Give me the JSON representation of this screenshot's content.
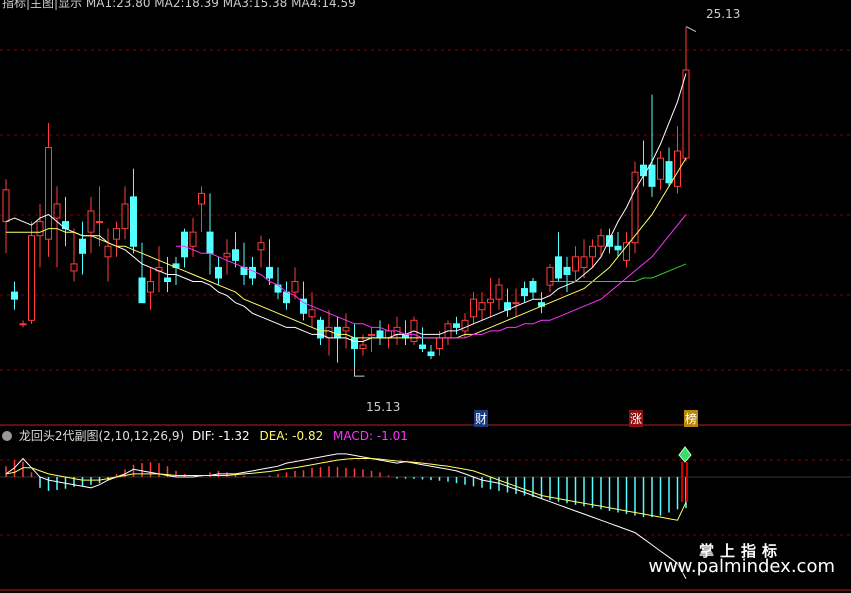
{
  "colors": {
    "up": "#ff3b3b",
    "down": "#54ffff",
    "ma1": "#ffffff",
    "ma2": "#ffff66",
    "ma3": "#ff33ff",
    "ma4": "#33cc33",
    "grid": "#8b0000",
    "divider": "#b22222",
    "dif": "#ffffff",
    "dea": "#ffff66",
    "macd_label": "#ff33ff"
  },
  "header": {
    "top_text": "指标|主图|显示  MA1:23.80  MA2:18.39  MA3:15.38  MA4:14.59",
    "sub_title": "龙回头2代副图(2,10,12,26,9)",
    "dif_label": "DIF: -1.32",
    "dea_label": "DEA: -0.82",
    "macd_label": "MACD: -1.01"
  },
  "annotations": {
    "high_label": "25.13",
    "low_label": "15.13",
    "tag_cai": "财",
    "tag_zhang": "涨",
    "tag_bang": "榜"
  },
  "watermark": {
    "line1": "掌上指标",
    "line2": "www.palmindex.com"
  },
  "chart_data": [
    {
      "type": "candlestick",
      "title": "",
      "ylim": [
        14.2,
        25.6
      ],
      "candles": [
        [
          19.6,
          20.8,
          18.7,
          20.5
        ],
        [
          17.6,
          17.9,
          17.1,
          17.4
        ],
        [
          16.7,
          16.8,
          16.6,
          16.7
        ],
        [
          16.8,
          19.6,
          16.7,
          19.2
        ],
        [
          19.2,
          20.1,
          18.3,
          19.6
        ],
        [
          19.1,
          22.4,
          18.6,
          21.7
        ],
        [
          19.7,
          20.6,
          18.3,
          20.1
        ],
        [
          19.6,
          20.3,
          18.9,
          19.4
        ],
        [
          18.2,
          19.4,
          17.9,
          18.4
        ],
        [
          19.1,
          19.6,
          18.1,
          18.7
        ],
        [
          19.3,
          20.3,
          18.7,
          19.9
        ],
        [
          19.6,
          20.6,
          18.9,
          19.6
        ],
        [
          18.6,
          19.4,
          17.9,
          18.9
        ],
        [
          19.1,
          19.6,
          18.6,
          19.4
        ],
        [
          19.4,
          20.6,
          19.1,
          20.1
        ],
        [
          20.3,
          21.1,
          18.7,
          18.9
        ],
        [
          18.0,
          19.0,
          17.3,
          17.3
        ],
        [
          17.6,
          18.3,
          17.1,
          17.9
        ],
        [
          18.2,
          18.9,
          17.6,
          18.3
        ],
        [
          18.0,
          18.6,
          17.6,
          17.9
        ],
        [
          18.4,
          18.6,
          17.8,
          18.3
        ],
        [
          19.3,
          19.4,
          18.3,
          18.6
        ],
        [
          18.9,
          19.7,
          18.6,
          19.3
        ],
        [
          20.1,
          20.6,
          19.3,
          20.4
        ],
        [
          19.3,
          20.4,
          18.1,
          18.7
        ],
        [
          18.3,
          18.6,
          17.8,
          18.0
        ],
        [
          18.6,
          19.1,
          18.1,
          18.7
        ],
        [
          18.8,
          19.3,
          18.3,
          18.5
        ],
        [
          18.3,
          19.0,
          17.8,
          18.1
        ],
        [
          18.3,
          18.6,
          17.8,
          18.0
        ],
        [
          18.8,
          19.2,
          18.3,
          19.0
        ],
        [
          18.3,
          19.1,
          17.8,
          18.0
        ],
        [
          17.8,
          18.3,
          17.4,
          17.6
        ],
        [
          17.6,
          17.9,
          17.1,
          17.3
        ],
        [
          17.6,
          18.3,
          17.4,
          17.9
        ],
        [
          17.4,
          17.9,
          16.8,
          17.0
        ],
        [
          16.9,
          17.6,
          16.6,
          17.1
        ],
        [
          16.8,
          16.9,
          16.1,
          16.3
        ],
        [
          16.3,
          17.1,
          15.8,
          16.6
        ],
        [
          16.6,
          16.9,
          15.6,
          16.3
        ],
        [
          16.5,
          17.0,
          16.0,
          16.6
        ],
        [
          16.3,
          16.7,
          15.5,
          16.0
        ],
        [
          16.0,
          16.4,
          15.8,
          16.1
        ],
        [
          16.4,
          16.6,
          15.9,
          16.4
        ],
        [
          16.5,
          16.8,
          16.1,
          16.3
        ],
        [
          16.3,
          16.7,
          16.0,
          16.5
        ],
        [
          16.4,
          16.9,
          16.1,
          16.6
        ],
        [
          16.4,
          16.8,
          16.1,
          16.3
        ],
        [
          16.2,
          16.9,
          16.1,
          16.8
        ],
        [
          16.1,
          16.6,
          15.9,
          16.0
        ],
        [
          15.9,
          16.1,
          15.7,
          15.8
        ],
        [
          16.0,
          16.5,
          15.8,
          16.3
        ],
        [
          16.3,
          16.8,
          16.1,
          16.7
        ],
        [
          16.7,
          16.9,
          16.4,
          16.6
        ],
        [
          16.5,
          17.0,
          16.3,
          16.8
        ],
        [
          16.9,
          17.6,
          16.7,
          17.4
        ],
        [
          17.1,
          17.6,
          16.8,
          17.3
        ],
        [
          17.3,
          18.0,
          16.9,
          17.4
        ],
        [
          17.4,
          18.0,
          17.1,
          17.8
        ],
        [
          17.3,
          17.7,
          16.9,
          17.1
        ],
        [
          17.3,
          17.7,
          16.9,
          17.3
        ],
        [
          17.7,
          17.9,
          17.3,
          17.5
        ],
        [
          17.9,
          18.0,
          17.4,
          17.6
        ],
        [
          17.3,
          17.6,
          17.0,
          17.2
        ],
        [
          17.8,
          18.4,
          17.6,
          18.3
        ],
        [
          18.6,
          19.3,
          17.9,
          18.0
        ],
        [
          18.3,
          18.6,
          17.6,
          18.1
        ],
        [
          18.2,
          18.9,
          17.9,
          18.6
        ],
        [
          18.3,
          19.1,
          18.0,
          18.6
        ],
        [
          18.6,
          19.1,
          18.3,
          18.9
        ],
        [
          18.9,
          19.4,
          18.6,
          19.2
        ],
        [
          19.2,
          19.4,
          18.7,
          18.9
        ],
        [
          18.9,
          19.3,
          18.6,
          18.8
        ],
        [
          18.5,
          19.3,
          18.3,
          19.0
        ],
        [
          19.0,
          21.3,
          18.7,
          21.0
        ],
        [
          21.2,
          21.9,
          20.6,
          20.9
        ],
        [
          21.2,
          23.2,
          20.3,
          20.6
        ],
        [
          20.8,
          21.6,
          20.5,
          21.4
        ],
        [
          21.3,
          21.7,
          20.6,
          20.7
        ],
        [
          20.6,
          22.3,
          20.4,
          21.6
        ],
        [
          21.4,
          25.1,
          21.3,
          23.9
        ]
      ],
      "ma1": [
        19.6,
        19.7,
        19.6,
        19.5,
        19.7,
        19.8,
        19.6,
        19.4,
        19.3,
        19.2,
        19.2,
        19.2,
        19.0,
        18.9,
        18.8,
        18.6,
        18.4,
        18.3,
        18.2,
        18.1,
        18.1,
        18.0,
        17.9,
        17.9,
        17.8,
        17.6,
        17.5,
        17.3,
        17.2,
        17.0,
        16.9,
        16.8,
        16.7,
        16.6,
        16.6,
        16.5,
        16.4,
        16.4,
        16.3,
        16.3,
        16.3,
        16.2,
        16.2,
        16.3,
        16.3,
        16.3,
        16.4,
        16.4,
        16.5,
        16.4,
        16.4,
        16.4,
        16.5,
        16.5,
        16.6,
        16.7,
        16.8,
        16.9,
        17.0,
        17.1,
        17.2,
        17.3,
        17.4,
        17.4,
        17.5,
        17.7,
        17.8,
        17.9,
        18.1,
        18.3,
        18.6,
        19.1,
        19.6,
        20.0,
        20.5,
        20.9,
        21.3,
        21.8,
        22.4,
        23.0,
        23.8
      ],
      "ma2": [
        19.3,
        19.3,
        19.3,
        19.3,
        19.3,
        19.4,
        19.4,
        19.3,
        19.3,
        19.2,
        19.2,
        19.1,
        19.0,
        18.9,
        18.9,
        18.8,
        18.7,
        18.6,
        18.5,
        18.4,
        18.3,
        18.2,
        18.1,
        18.0,
        17.9,
        17.8,
        17.7,
        17.6,
        17.4,
        17.3,
        17.2,
        17.1,
        17.0,
        16.9,
        16.8,
        16.7,
        16.6,
        16.5,
        16.5,
        16.4,
        16.4,
        16.3,
        16.3,
        16.3,
        16.3,
        16.3,
        16.3,
        16.3,
        16.3,
        16.3,
        16.3,
        16.3,
        16.3,
        16.3,
        16.4,
        16.4,
        16.5,
        16.6,
        16.7,
        16.8,
        16.9,
        17.0,
        17.1,
        17.2,
        17.3,
        17.4,
        17.5,
        17.6,
        17.7,
        17.9,
        18.1,
        18.3,
        18.6,
        18.9,
        19.2,
        19.5,
        19.8,
        20.2,
        20.6,
        21.0,
        21.4
      ],
      "ma3": [
        null,
        null,
        null,
        null,
        null,
        null,
        null,
        null,
        null,
        null,
        null,
        null,
        null,
        null,
        null,
        null,
        null,
        null,
        null,
        null,
        18.9,
        18.9,
        18.8,
        18.7,
        18.7,
        18.6,
        18.5,
        18.4,
        18.3,
        18.2,
        18.1,
        17.9,
        17.8,
        17.6,
        17.5,
        17.3,
        17.2,
        17.1,
        17.0,
        16.9,
        16.8,
        16.7,
        16.7,
        16.6,
        16.6,
        16.5,
        16.5,
        16.4,
        16.4,
        16.3,
        16.3,
        16.3,
        16.3,
        16.3,
        16.3,
        16.4,
        16.4,
        16.5,
        16.5,
        16.6,
        16.6,
        16.7,
        16.7,
        16.8,
        16.8,
        16.9,
        17.0,
        17.1,
        17.2,
        17.3,
        17.4,
        17.6,
        17.8,
        18.0,
        18.2,
        18.4,
        18.6,
        18.9,
        19.2,
        19.5,
        19.8
      ],
      "ma4": [
        null,
        null,
        null,
        null,
        null,
        null,
        null,
        null,
        null,
        null,
        null,
        null,
        null,
        null,
        null,
        null,
        null,
        null,
        null,
        null,
        null,
        null,
        null,
        null,
        null,
        null,
        null,
        null,
        null,
        null,
        null,
        null,
        null,
        null,
        null,
        null,
        null,
        null,
        null,
        null,
        null,
        null,
        null,
        null,
        null,
        null,
        null,
        null,
        null,
        null,
        null,
        null,
        null,
        null,
        null,
        null,
        null,
        null,
        null,
        null,
        null,
        null,
        null,
        null,
        17.9,
        17.9,
        17.9,
        17.9,
        17.9,
        17.9,
        17.9,
        17.9,
        17.9,
        17.9,
        17.9,
        18.0,
        18.0,
        18.1,
        18.2,
        18.3,
        18.4
      ],
      "legend": [
        "MA1: 23.80",
        "MA2: 18.39",
        "MA3: 15.38",
        "MA4: 14.59"
      ]
    },
    {
      "type": "bar",
      "title": "龙回头2代副图(2,10,12,26,9)",
      "ylim": [
        -3.5,
        1.2
      ],
      "macd": [
        0.35,
        0.55,
        0.5,
        0.15,
        -0.35,
        -0.45,
        -0.42,
        -0.38,
        -0.32,
        -0.3,
        -0.25,
        -0.2,
        -0.1,
        0.1,
        0.25,
        0.4,
        0.45,
        0.48,
        0.45,
        0.35,
        0.2,
        0.1,
        0.0,
        0.05,
        0.15,
        0.2,
        0.15,
        0.1,
        0.05,
        0.0,
        0.0,
        0.05,
        0.1,
        0.15,
        0.2,
        0.22,
        0.3,
        0.32,
        0.35,
        0.33,
        0.3,
        0.28,
        0.25,
        0.2,
        0.15,
        0.05,
        -0.05,
        -0.05,
        -0.06,
        -0.08,
        -0.1,
        -0.12,
        -0.15,
        -0.2,
        -0.25,
        -0.3,
        -0.35,
        -0.4,
        -0.45,
        -0.5,
        -0.55,
        -0.6,
        -0.65,
        -0.7,
        -0.75,
        -0.8,
        -0.85,
        -0.9,
        -0.95,
        -1.0,
        -1.05,
        -1.1,
        -1.15,
        -1.2,
        -1.25,
        -1.3,
        -1.3,
        -1.25,
        -1.15,
        -1.05,
        -1.01
      ],
      "dif": [
        0.1,
        0.3,
        0.6,
        0.3,
        0.0,
        -0.1,
        -0.15,
        -0.2,
        -0.25,
        -0.3,
        -0.35,
        -0.25,
        -0.1,
        0.0,
        0.1,
        0.25,
        0.2,
        0.15,
        0.1,
        0.05,
        0.0,
        0.0,
        0.0,
        0.05,
        0.05,
        0.1,
        0.1,
        0.1,
        0.15,
        0.2,
        0.25,
        0.3,
        0.35,
        0.45,
        0.5,
        0.55,
        0.6,
        0.65,
        0.7,
        0.75,
        0.75,
        0.7,
        0.65,
        0.6,
        0.55,
        0.5,
        0.45,
        0.5,
        0.45,
        0.4,
        0.35,
        0.3,
        0.25,
        0.2,
        0.1,
        0.0,
        -0.1,
        -0.15,
        -0.2,
        -0.3,
        -0.4,
        -0.5,
        -0.6,
        -0.7,
        -0.8,
        -0.9,
        -1.0,
        -1.1,
        -1.2,
        -1.3,
        -1.4,
        -1.5,
        -1.6,
        -1.7,
        -1.8,
        -2.0,
        -2.2,
        -2.4,
        -2.6,
        -2.8,
        -3.3
      ],
      "dea": [
        0.1,
        0.15,
        0.3,
        0.3,
        0.2,
        0.1,
        0.05,
        0.0,
        -0.05,
        -0.1,
        -0.1,
        -0.1,
        -0.05,
        0.0,
        0.05,
        0.1,
        0.1,
        0.1,
        0.1,
        0.08,
        0.05,
        0.05,
        0.05,
        0.05,
        0.05,
        0.05,
        0.05,
        0.08,
        0.1,
        0.12,
        0.15,
        0.18,
        0.22,
        0.27,
        0.3,
        0.35,
        0.4,
        0.45,
        0.5,
        0.55,
        0.58,
        0.6,
        0.6,
        0.6,
        0.58,
        0.55,
        0.52,
        0.5,
        0.48,
        0.45,
        0.42,
        0.38,
        0.35,
        0.3,
        0.25,
        0.2,
        0.1,
        0.0,
        -0.1,
        -0.2,
        -0.3,
        -0.4,
        -0.5,
        -0.6,
        -0.65,
        -0.7,
        -0.75,
        -0.8,
        -0.85,
        -0.9,
        -0.95,
        -1.0,
        -1.05,
        -1.1,
        -1.15,
        -1.2,
        -1.25,
        -1.3,
        -1.35,
        -1.4,
        -0.82
      ]
    }
  ]
}
